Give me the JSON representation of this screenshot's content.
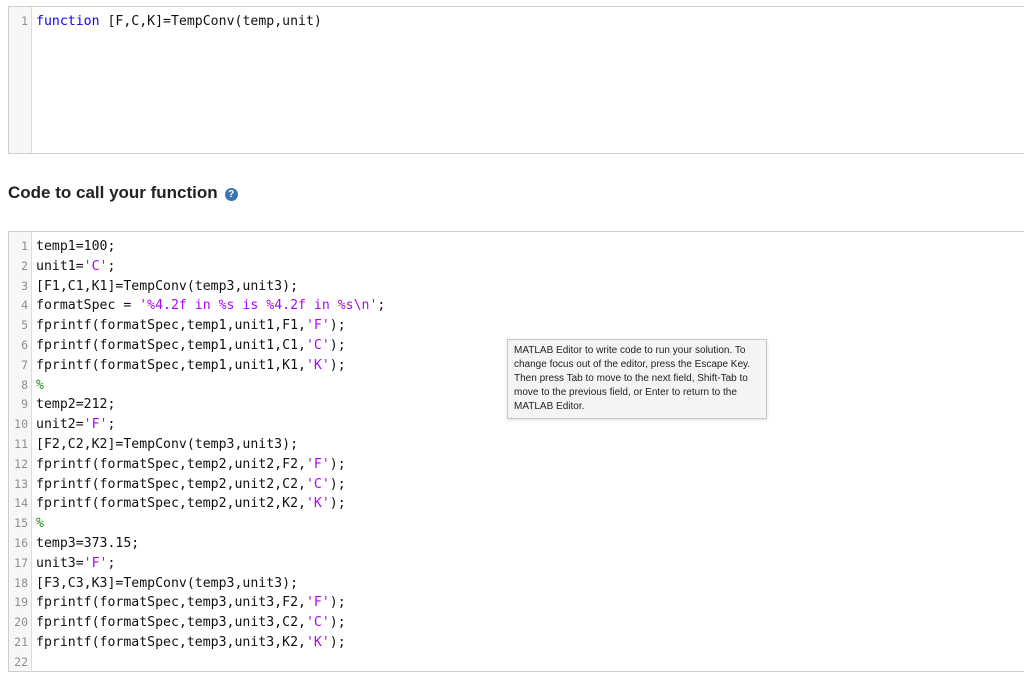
{
  "function_editor": {
    "lines": [
      {
        "num": "1",
        "tokens": [
          {
            "text": "function",
            "cls": "kw"
          },
          {
            "text": " [F,C,K]=TempConv(temp,unit)",
            "cls": ""
          }
        ]
      }
    ]
  },
  "section": {
    "title": "Code to call your function",
    "help_icon": "?"
  },
  "call_editor": {
    "lines": [
      {
        "num": "1",
        "tokens": [
          {
            "text": "temp1=100;",
            "cls": ""
          }
        ]
      },
      {
        "num": "2",
        "tokens": [
          {
            "text": "unit1=",
            "cls": ""
          },
          {
            "text": "'C'",
            "cls": "str"
          },
          {
            "text": ";",
            "cls": ""
          }
        ]
      },
      {
        "num": "3",
        "tokens": [
          {
            "text": "[F1,C1,K1]=TempConv(temp3,unit3);",
            "cls": ""
          }
        ]
      },
      {
        "num": "4",
        "tokens": [
          {
            "text": "formatSpec = ",
            "cls": ""
          },
          {
            "text": "'%4.2f in %s is %4.2f in %s\\n'",
            "cls": "str"
          },
          {
            "text": ";",
            "cls": ""
          }
        ]
      },
      {
        "num": "5",
        "tokens": [
          {
            "text": "fprintf(formatSpec,temp1,unit1,F1,",
            "cls": ""
          },
          {
            "text": "'F'",
            "cls": "str"
          },
          {
            "text": ");",
            "cls": ""
          }
        ]
      },
      {
        "num": "6",
        "tokens": [
          {
            "text": "fprintf(formatSpec,temp1,unit1,C1,",
            "cls": ""
          },
          {
            "text": "'C'",
            "cls": "str"
          },
          {
            "text": ");",
            "cls": ""
          }
        ]
      },
      {
        "num": "7",
        "tokens": [
          {
            "text": "fprintf(formatSpec,temp1,unit1,K1,",
            "cls": ""
          },
          {
            "text": "'K'",
            "cls": "str"
          },
          {
            "text": ");",
            "cls": ""
          }
        ]
      },
      {
        "num": "8",
        "tokens": [
          {
            "text": "%",
            "cls": "cmt"
          }
        ]
      },
      {
        "num": "9",
        "tokens": [
          {
            "text": "temp2=212;",
            "cls": ""
          }
        ]
      },
      {
        "num": "10",
        "tokens": [
          {
            "text": "unit2=",
            "cls": ""
          },
          {
            "text": "'F'",
            "cls": "str"
          },
          {
            "text": ";",
            "cls": ""
          }
        ]
      },
      {
        "num": "11",
        "tokens": [
          {
            "text": "[F2,C2,K2]=TempConv(temp3,unit3);",
            "cls": ""
          }
        ]
      },
      {
        "num": "12",
        "tokens": [
          {
            "text": "fprintf(formatSpec,temp2,unit2,F2,",
            "cls": ""
          },
          {
            "text": "'F'",
            "cls": "str"
          },
          {
            "text": ");",
            "cls": ""
          }
        ]
      },
      {
        "num": "13",
        "tokens": [
          {
            "text": "fprintf(formatSpec,temp2,unit2,C2,",
            "cls": ""
          },
          {
            "text": "'C'",
            "cls": "str"
          },
          {
            "text": ");",
            "cls": ""
          }
        ]
      },
      {
        "num": "14",
        "tokens": [
          {
            "text": "fprintf(formatSpec,temp2,unit2,K2,",
            "cls": ""
          },
          {
            "text": "'K'",
            "cls": "str"
          },
          {
            "text": ");",
            "cls": ""
          }
        ]
      },
      {
        "num": "15",
        "tokens": [
          {
            "text": "%",
            "cls": "cmt"
          }
        ]
      },
      {
        "num": "16",
        "tokens": [
          {
            "text": "temp3=373.15;",
            "cls": ""
          }
        ]
      },
      {
        "num": "17",
        "tokens": [
          {
            "text": "unit3=",
            "cls": ""
          },
          {
            "text": "'F'",
            "cls": "str"
          },
          {
            "text": ";",
            "cls": ""
          }
        ]
      },
      {
        "num": "18",
        "tokens": [
          {
            "text": "[F3,C3,K3]=TempConv(temp3,unit3);",
            "cls": ""
          }
        ]
      },
      {
        "num": "19",
        "tokens": [
          {
            "text": "fprintf(formatSpec,temp3,unit3,F2,",
            "cls": ""
          },
          {
            "text": "'F'",
            "cls": "str"
          },
          {
            "text": ");",
            "cls": ""
          }
        ]
      },
      {
        "num": "20",
        "tokens": [
          {
            "text": "fprintf(formatSpec,temp3,unit3,C2,",
            "cls": ""
          },
          {
            "text": "'C'",
            "cls": "str"
          },
          {
            "text": ");",
            "cls": ""
          }
        ]
      },
      {
        "num": "21",
        "tokens": [
          {
            "text": "fprintf(formatSpec,temp3,unit3,K2,",
            "cls": ""
          },
          {
            "text": "'K'",
            "cls": "str"
          },
          {
            "text": ");",
            "cls": ""
          }
        ]
      },
      {
        "num": "22",
        "tokens": []
      }
    ]
  },
  "tooltip": {
    "text": "MATLAB Editor to write code to run your solution. To change focus out of the editor, press the Escape Key. Then press Tab to move to the next field, Shift-Tab to move to the previous field, or Enter to return to the MATLAB Editor."
  },
  "colors": {
    "keyword": "#0e00ff",
    "string": "#a709f5",
    "comment": "#228b22",
    "line_number": "#8e8e8e",
    "help_icon": "#3b73b9"
  },
  "icons": {
    "help": "help-circle-icon"
  }
}
